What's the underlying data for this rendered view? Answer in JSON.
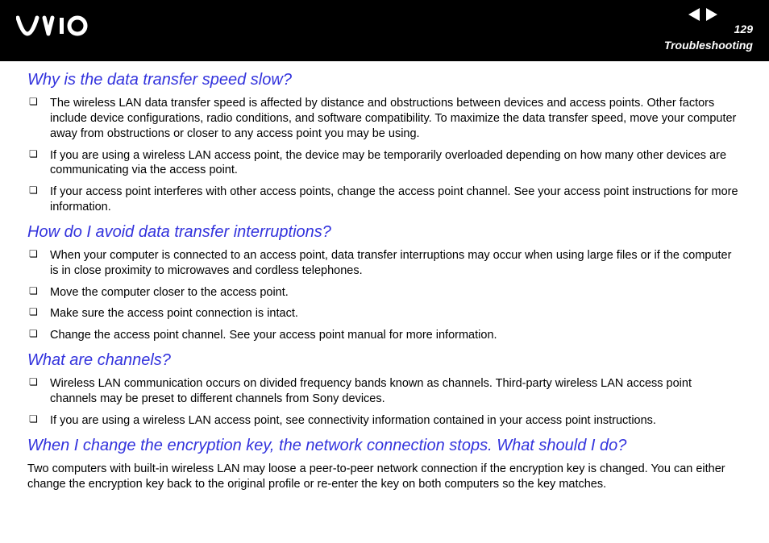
{
  "header": {
    "page_number": "129",
    "section": "Troubleshooting"
  },
  "sections": [
    {
      "question": "Why is the data transfer speed slow?",
      "bullets": [
        "The wireless LAN data transfer speed is affected by distance and obstructions between devices and access points. Other factors include device configurations, radio conditions, and software compatibility. To maximize the data transfer speed, move your computer away from obstructions or closer to any access point you may be using.",
        "If you are using a wireless LAN access point, the device may be temporarily overloaded depending on how many other devices are communicating via the access point.",
        "If your access point interferes with other access points, change the access point channel. See your access point instructions for more information."
      ]
    },
    {
      "question": "How do I avoid data transfer interruptions?",
      "bullets": [
        "When your computer is connected to an access point, data transfer interruptions may occur when using large files or if the computer is in close proximity to microwaves and cordless telephones.",
        "Move the computer closer to the access point.",
        "Make sure the access point connection is intact.",
        "Change the access point channel. See your access point manual for more information."
      ]
    },
    {
      "question": "What are channels?",
      "bullets": [
        "Wireless LAN communication occurs on divided frequency bands known as channels. Third-party wireless LAN access point channels may be preset to different channels from Sony devices.",
        "If you are using a wireless LAN access point, see connectivity information contained in your access point instructions."
      ]
    },
    {
      "question": "When I change the encryption key, the network connection stops. What should I do?",
      "paragraph": "Two computers with built-in wireless LAN may loose a peer-to-peer network connection if the encryption key is changed. You can either change the encryption key back to the original profile or re-enter the key on both computers so the key matches."
    }
  ]
}
